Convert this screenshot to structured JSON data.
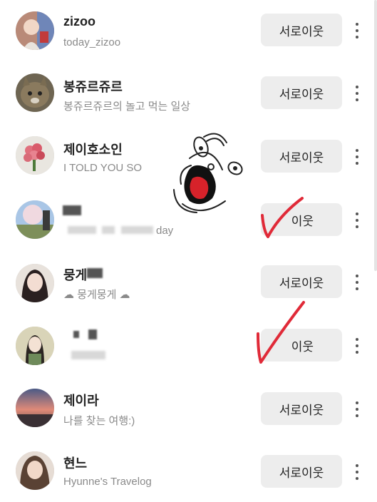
{
  "following": [
    {
      "name": "zizoo",
      "subtitle": "today_zizoo",
      "button": "서로이웃"
    },
    {
      "name": "봉쥬르쥬르",
      "subtitle": "봉쥬르쥬르의 놀고 먹는 일상",
      "button": "서로이웃"
    },
    {
      "name": "제이호소인",
      "subtitle": "I TOLD YOU SO",
      "button": "서로이웃"
    },
    {
      "name": "",
      "subtitle": "day",
      "button": "이웃"
    },
    {
      "name": "뭉게",
      "subtitle": "☁ 뭉게뭉게 ☁",
      "button": "서로이웃"
    },
    {
      "name": "",
      "subtitle": "",
      "button": "이웃"
    },
    {
      "name": "제이라",
      "subtitle": "나를 찾는 여행:)",
      "button": "서로이웃"
    },
    {
      "name": "현느",
      "subtitle": "Hyunne's Travelog",
      "button": "서로이웃"
    }
  ],
  "icons": {
    "more": "more-vertical-icon"
  },
  "colors": {
    "button_bg": "#ededed",
    "annotation_red": "#e02a38"
  }
}
